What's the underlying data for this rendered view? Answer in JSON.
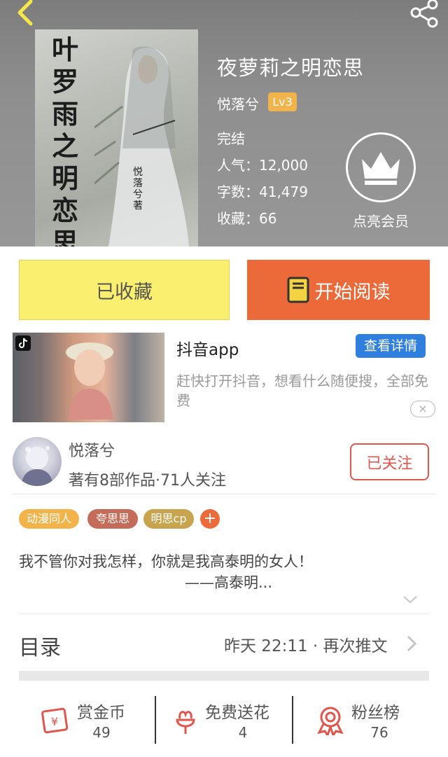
{
  "header": {
    "book_title": "夜萝莉之明恋思",
    "author": "悦落兮",
    "level": "Lv3",
    "status": "完结",
    "popularity": "人气：12,000",
    "word_count": "字数：41,479",
    "favorites": "收藏：66",
    "vip_label": "点亮会员",
    "cover_title": "叶罗雨之明恋思",
    "cover_author": "悦落兮著"
  },
  "actions": {
    "collect_label": "已收藏",
    "read_label": "开始阅读"
  },
  "ad": {
    "title": "抖音app",
    "detail_button": "查看详情",
    "description": "赶快打开抖音，想看什么随便搜，全部免费",
    "close": "×"
  },
  "author_card": {
    "name": "悦落兮",
    "stats": "著有8部作品·71人关注",
    "follow_label": "已关注"
  },
  "tags": [
    {
      "label": "动漫同人",
      "color": "#f2b34a"
    },
    {
      "label": "夸思思",
      "color": "#c56b5a"
    },
    {
      "label": "明思cp",
      "color": "#c9a44e"
    }
  ],
  "tag_add": "+",
  "intro": {
    "line1": "我不管你对我怎样，你就是我高泰明的女人！",
    "line2": "——高泰明..."
  },
  "catalog": {
    "title": "目录",
    "update": "昨天 22:11 · 再次推文"
  },
  "stats": [
    {
      "label": "赏金币",
      "value": "49",
      "icon": "red-envelope-icon"
    },
    {
      "label": "免费送花",
      "value": "4",
      "icon": "flower-icon"
    },
    {
      "label": "粉丝榜",
      "value": "76",
      "icon": "medal-icon"
    }
  ],
  "colors": {
    "accent_orange": "#ec6a39",
    "collect_yellow": "#fbef6f",
    "icon_red": "#e0564d",
    "ad_blue": "#2f7fde"
  }
}
